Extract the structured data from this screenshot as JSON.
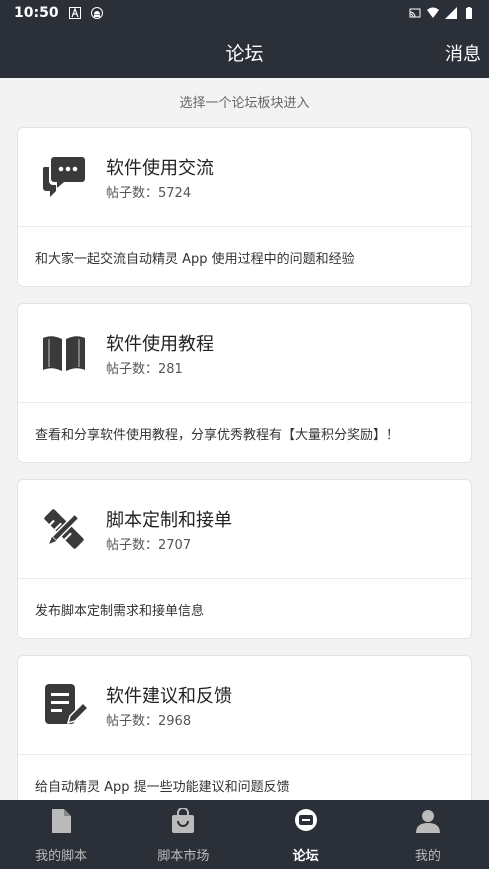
{
  "status_bar": {
    "time": "10:50",
    "icons": [
      "a-icon",
      "android-icon",
      "cast-icon",
      "wifi-icon",
      "signal-icon",
      "battery-icon"
    ]
  },
  "app_bar": {
    "title": "论坛",
    "action_label": "消息"
  },
  "hint": "选择一个论坛板块进入",
  "boards": [
    {
      "icon": "chat-bubbles-icon",
      "name": "软件使用交流",
      "count_label": "帖子数：",
      "count": "5724",
      "description": "和大家一起交流自动精灵 App 使用过程中的问题和经验"
    },
    {
      "icon": "book-icon",
      "name": "软件使用教程",
      "count_label": "帖子数：",
      "count": "281",
      "description": "查看和分享软件使用教程，分享优秀教程有【大量积分奖励】！"
    },
    {
      "icon": "tools-icon",
      "name": "脚本定制和接单",
      "count_label": "帖子数：",
      "count": "2707",
      "description": "发布脚本定制需求和接单信息"
    },
    {
      "icon": "edit-document-icon",
      "name": "软件建议和反馈",
      "count_label": "帖子数：",
      "count": "2968",
      "description": "给自动精灵 App 提一些功能建议和问题反馈"
    }
  ],
  "bottom_nav": [
    {
      "icon": "file-icon",
      "label": "我的脚本",
      "active": false
    },
    {
      "icon": "shopping-bag-icon",
      "label": "脚本市场",
      "active": false
    },
    {
      "icon": "forum-icon",
      "label": "论坛",
      "active": true
    },
    {
      "icon": "person-icon",
      "label": "我的",
      "active": false
    }
  ],
  "colors": {
    "bar_bg": "#2b2f38",
    "page_bg": "#f3f3f3",
    "card_bg": "#ffffff",
    "icon": "#3a3a3a"
  }
}
